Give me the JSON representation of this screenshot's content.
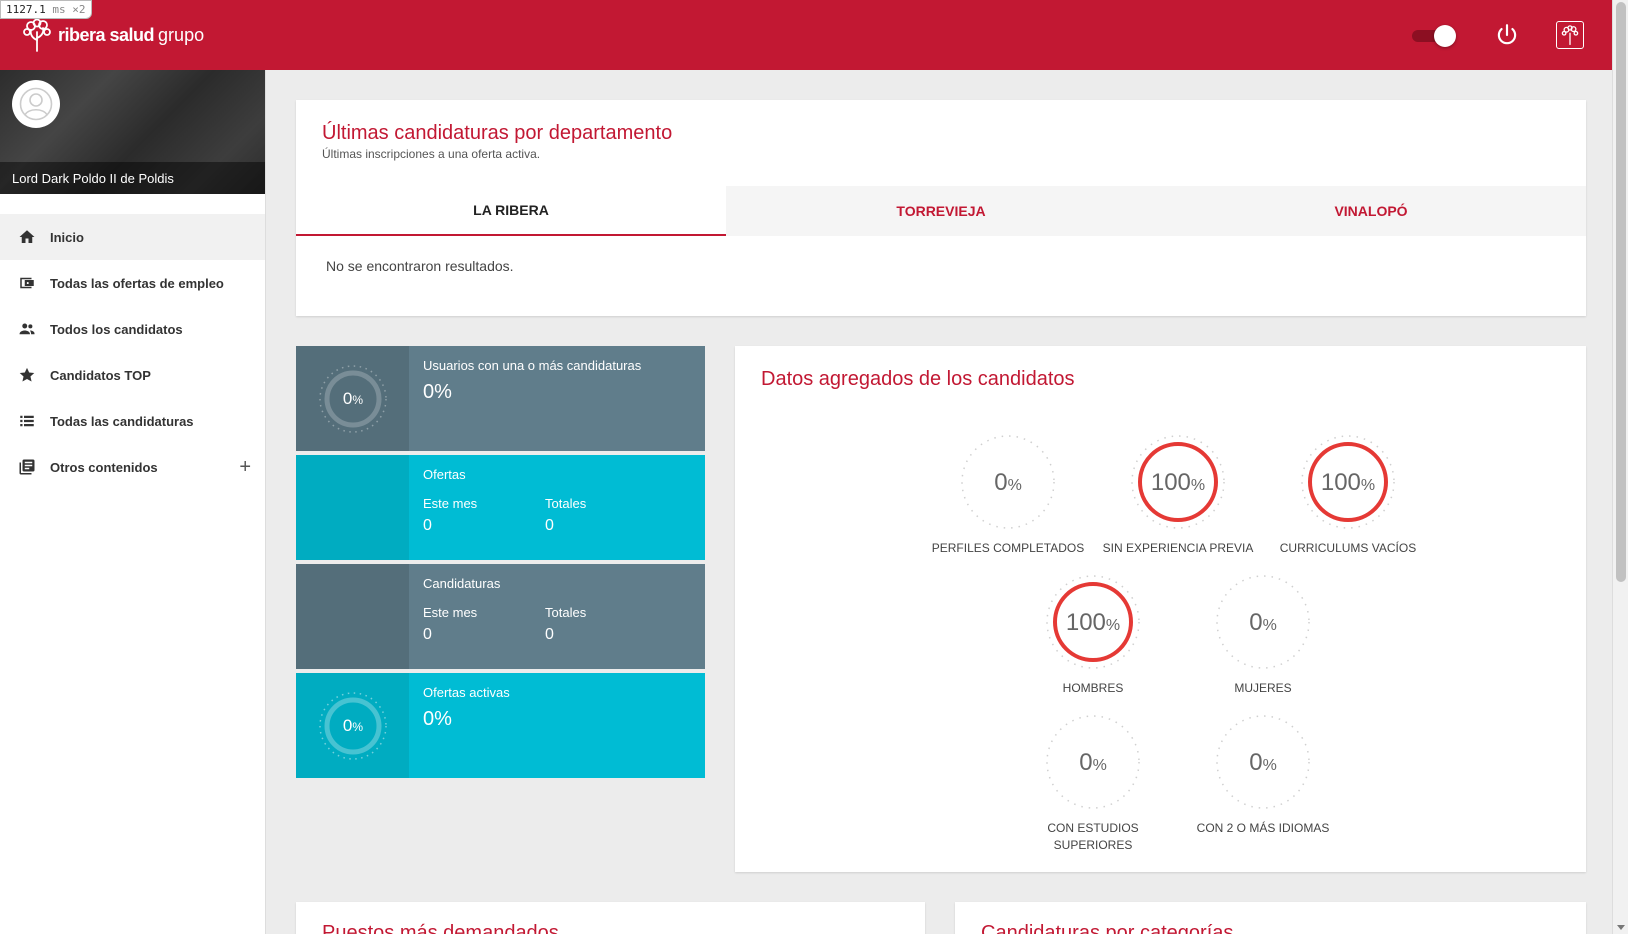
{
  "debug": {
    "timing_value": "1127.1",
    "timing_unit": "ms",
    "timing_mult": "×2"
  },
  "brand": {
    "name_bold": "ribera salud",
    "name_light": "grupo"
  },
  "header": {
    "toggle_on": true,
    "colors": {
      "brand": "#c21833"
    }
  },
  "user": {
    "name": "Lord Dark Poldo II de Poldis"
  },
  "sidebar": {
    "items": [
      {
        "label": "Inicio",
        "icon": "home-icon",
        "active": true
      },
      {
        "label": "Todas las ofertas de empleo",
        "icon": "wallet-icon"
      },
      {
        "label": "Todos los candidatos",
        "icon": "people-icon"
      },
      {
        "label": "Candidatos TOP",
        "icon": "star-icon"
      },
      {
        "label": "Todas las candidaturas",
        "icon": "list-icon"
      },
      {
        "label": "Otros contenidos",
        "icon": "library-icon",
        "expand": "+"
      }
    ]
  },
  "departments": {
    "title": "Últimas candidaturas por departamento",
    "subtitle": "Últimas inscripciones a una oferta activa.",
    "tabs": [
      "LA RIBERA",
      "TORREVIEJA",
      "VINALOPÓ"
    ],
    "active_tab": 0,
    "empty": "No se encontraron resultados."
  },
  "tiles": {
    "users": {
      "label": "Usuarios con una o más candidaturas",
      "value": "0%",
      "ring_value": "0",
      "ring_unit": "%"
    },
    "offers": {
      "label": "Ofertas",
      "month_label": "Este mes",
      "month_value": "0",
      "total_label": "Totales",
      "total_value": "0"
    },
    "applications": {
      "label": "Candidaturas",
      "month_label": "Este mes",
      "month_value": "0",
      "total_label": "Totales",
      "total_value": "0"
    },
    "active_offers": {
      "label": "Ofertas activas",
      "value": "0%",
      "ring_value": "0",
      "ring_unit": "%"
    }
  },
  "aggregated": {
    "title": "Datos agregados de los candidatos",
    "gauges": [
      {
        "value": "0",
        "unit": "%",
        "label": "PERFILES COMPLETADOS",
        "pct": 0
      },
      {
        "value": "100",
        "unit": "%",
        "label": "SIN EXPERIENCIA PREVIA",
        "pct": 100
      },
      {
        "value": "100",
        "unit": "%",
        "label": "CURRICULUMS VACÍOS",
        "pct": 100
      },
      {
        "value": "100",
        "unit": "%",
        "label": "HOMBRES",
        "pct": 100
      },
      {
        "value": "0",
        "unit": "%",
        "label": "MUJERES",
        "pct": 0
      },
      {
        "value": "0",
        "unit": "%",
        "label": "CON ESTUDIOS SUPERIORES",
        "pct": 0
      },
      {
        "value": "0",
        "unit": "%",
        "label": "CON 2 O MÁS IDIOMAS",
        "pct": 0
      }
    ]
  },
  "bottom": {
    "left_title": "Puestos más demandados",
    "right_title": "Candidaturas por categorías"
  }
}
